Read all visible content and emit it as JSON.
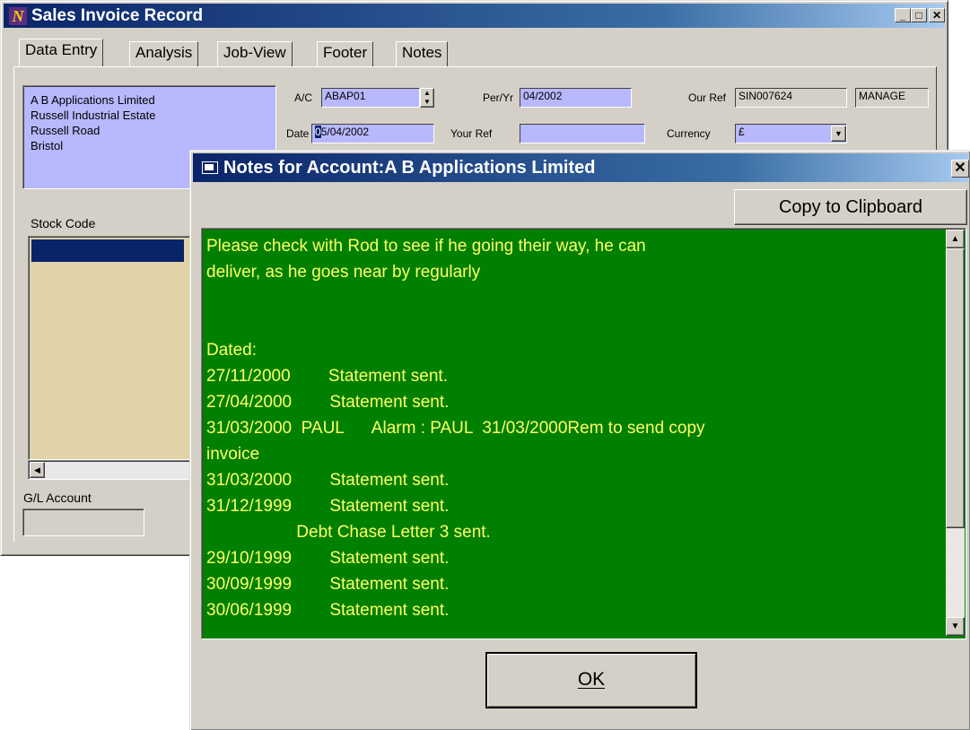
{
  "main_window": {
    "title": "Sales Invoice Record",
    "app_icon": "N",
    "tabs": [
      "Data Entry",
      "Analysis",
      "Job-View",
      "Footer",
      "Notes"
    ],
    "address_lines": [
      "A B Applications Limited",
      "Russell Industrial Estate",
      "Russell Road",
      "Bristol"
    ],
    "ac": {
      "label": "A/C",
      "value": "ABAP01"
    },
    "per_yr": {
      "label": "Per/Yr",
      "value": "04/2002"
    },
    "our_ref": {
      "label": "Our Ref",
      "value": "SIN007624"
    },
    "manage": "MANAGE",
    "date": {
      "label": "Date",
      "value_selected": "0",
      "value_rest": "5/04/2002"
    },
    "your_ref": {
      "label": "Your Ref",
      "value": ""
    },
    "currency": {
      "label": "Currency",
      "value": "£"
    },
    "stock_code_header": "Stock Code",
    "gl_account_label": "G/L Account",
    "colors": {
      "field_bg": "#b8b8ff",
      "list_bg": "#e0d3a8",
      "selection": "#0a246a"
    }
  },
  "notes_dialog": {
    "title": "Notes for Account:A B Applications Limited",
    "copy_button": "Copy to Clipboard",
    "ok_button": "OK",
    "lines": [
      "Please check with Rod to see if he going their way, he can",
      "deliver, as he goes near by regularly",
      "",
      "",
      "Dated:",
      "27/11/2000        Statement sent.",
      "27/04/2000        Statement sent.",
      "31/03/2000  PAUL      Alarm : PAUL  31/03/2000Rem to send copy",
      "invoice",
      "31/03/2000        Statement sent.",
      "31/12/1999        Statement sent.",
      "                   Debt Chase Letter 3 sent.",
      "29/10/1999        Statement sent.",
      "30/09/1999        Statement sent.",
      "30/06/1999        Statement sent."
    ],
    "colors": {
      "notes_bg": "#008000",
      "notes_text": "#ffff66"
    }
  }
}
